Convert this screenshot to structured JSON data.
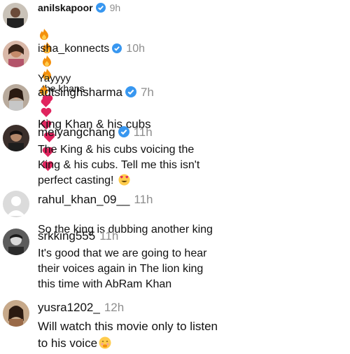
{
  "comments": [
    {
      "username": "anilskapoor",
      "verified": true,
      "time": "9h",
      "prefix_emojis": [
        "fire",
        "fire",
        "fire",
        "fire"
      ],
      "text": "the khans",
      "suffix_emojis": [
        "heart",
        "heart",
        "heart"
      ]
    },
    {
      "username": "isha_konnects",
      "verified": true,
      "time": "10h",
      "text": "Yayyyy",
      "suffix_emojis": [
        "fire",
        "heart"
      ]
    },
    {
      "username": "adtsinghsharma",
      "verified": true,
      "time": "7h",
      "text": "King Khan & his cubs",
      "suffix_emojis": [
        "heart",
        "heart",
        "heart"
      ]
    },
    {
      "username": "meiyangchang",
      "verified": true,
      "time": "11h",
      "text": "The King & his cubs voicing the\nKing & his cubs. Tell me this isn't\nperfect casting!",
      "suffix_emojis": [
        "heart-eyes"
      ]
    },
    {
      "username": "rahul_khan_09__",
      "verified": false,
      "time": "11h",
      "text": "So the king is dubbing another king"
    },
    {
      "username": "srkking555",
      "verified": false,
      "time": "11h",
      "text": "It's good that we are going to hear\ntheir voices again in The lion king\nthis time with AbRam Khan"
    },
    {
      "username": "yusra1202_",
      "verified": false,
      "time": "12h",
      "text": "Will watch this movie only to listen\nto his voice",
      "suffix_emojis": [
        "blushing-face"
      ]
    }
  ],
  "colors": {
    "verified": "#3897f0",
    "time": "#8e8e8e",
    "heart": "#e0245e",
    "fire": "#f4900c"
  }
}
